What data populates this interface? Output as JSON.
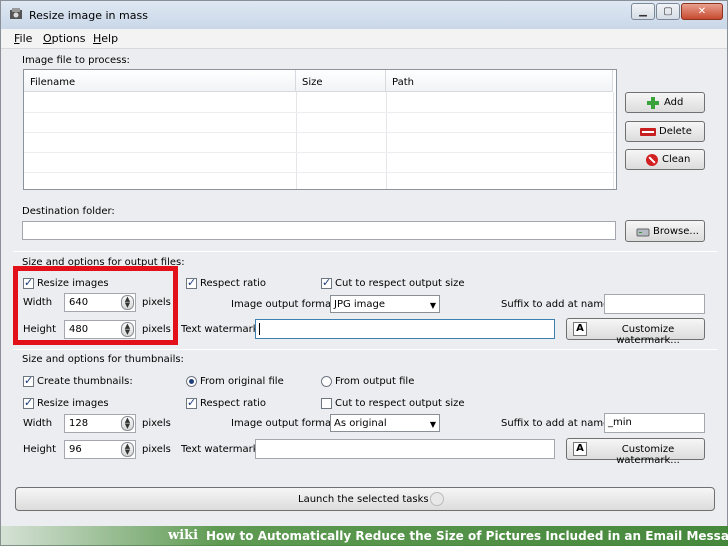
{
  "window": {
    "title": "Resize image in mass"
  },
  "menu": [
    {
      "label": "File",
      "key": "F",
      "rest": "ile"
    },
    {
      "label": "Options",
      "key": "O",
      "rest": "ptions"
    },
    {
      "label": "Help",
      "key": "H",
      "rest": "elp"
    }
  ],
  "files": {
    "section": "Image file to process:",
    "columns": [
      "Filename",
      "Size",
      "Path"
    ],
    "add": "Add",
    "delete": "Delete",
    "clean": "Clean"
  },
  "destination": {
    "label": "Destination folder:",
    "value": "",
    "browse": "Browse..."
  },
  "output": {
    "section": "Size and options for output files:",
    "resize_images": "Resize images",
    "width_label": "Width",
    "width": "640",
    "height_label": "Height",
    "height": "480",
    "pixels": "pixels",
    "respect_ratio": "Respect ratio",
    "cut": "Cut to respect output size",
    "format_label": "Image output format:",
    "format": "JPG image",
    "suffix_label": "Suffix to add at name:",
    "suffix": "",
    "watermark_label": "Text watermark:",
    "watermark": "",
    "customize": "Customize watermark..."
  },
  "thumbs": {
    "section": "Size and options for thumbnails:",
    "create": "Create thumbnails:",
    "from_original": "From original file",
    "from_output": "From output file",
    "resize_images": "Resize images",
    "width_label": "Width",
    "width": "128",
    "height_label": "Height",
    "height": "96",
    "pixels": "pixels",
    "respect_ratio": "Respect ratio",
    "cut": "Cut to respect output size",
    "format_label": "Image output format:",
    "format": "As original",
    "suffix_label": "Suffix to add at name:",
    "suffix": "_min",
    "watermark_label": "Text watermark:",
    "watermark": "",
    "customize": "Customize watermark..."
  },
  "launch": "Launch the selected tasks",
  "banner": {
    "wiki": "wiki",
    "text": "How to Automatically Reduce the Size of Pictures Included in an Email Message"
  }
}
